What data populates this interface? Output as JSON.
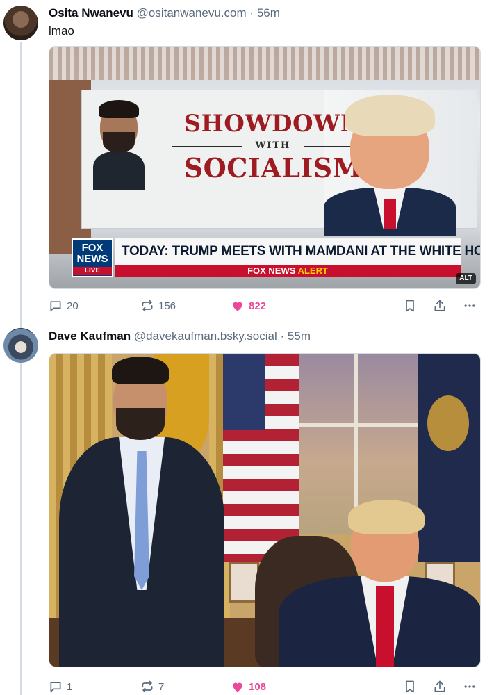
{
  "posts": [
    {
      "author_name": "Osita Nwanevu",
      "handle": "@ositanwanevu.com",
      "separator": "·",
      "time": "56m",
      "text": "lmao",
      "image": {
        "headline_top": "SHOWDOWN",
        "headline_mid": "WITH",
        "headline_bottom": "SOCIALISM",
        "logo_line1": "FOX",
        "logo_line2": "NEWS",
        "logo_live": "LIVE",
        "chyron": "TODAY: TRUMP MEETS WITH MAMDANI AT THE WHITE HOUSE",
        "alert_prefix": "FOX NEWS",
        "alert_word": "ALERT",
        "alt_badge": "ALT"
      },
      "replies": "20",
      "reposts": "156",
      "likes": "822",
      "liked": true
    },
    {
      "author_name": "Dave Kaufman",
      "handle": "@davekaufman.bsky.social",
      "separator": "·",
      "time": "55m",
      "replies": "1",
      "reposts": "7",
      "likes": "108",
      "liked": true
    }
  ],
  "colors": {
    "like_active": "#ec4899",
    "muted_text": "#5b6b7d",
    "thread_line": "#d4dbe2"
  },
  "icons": [
    "reply-icon",
    "repost-icon",
    "heart-icon",
    "bookmark-icon",
    "share-icon",
    "more-icon"
  ]
}
